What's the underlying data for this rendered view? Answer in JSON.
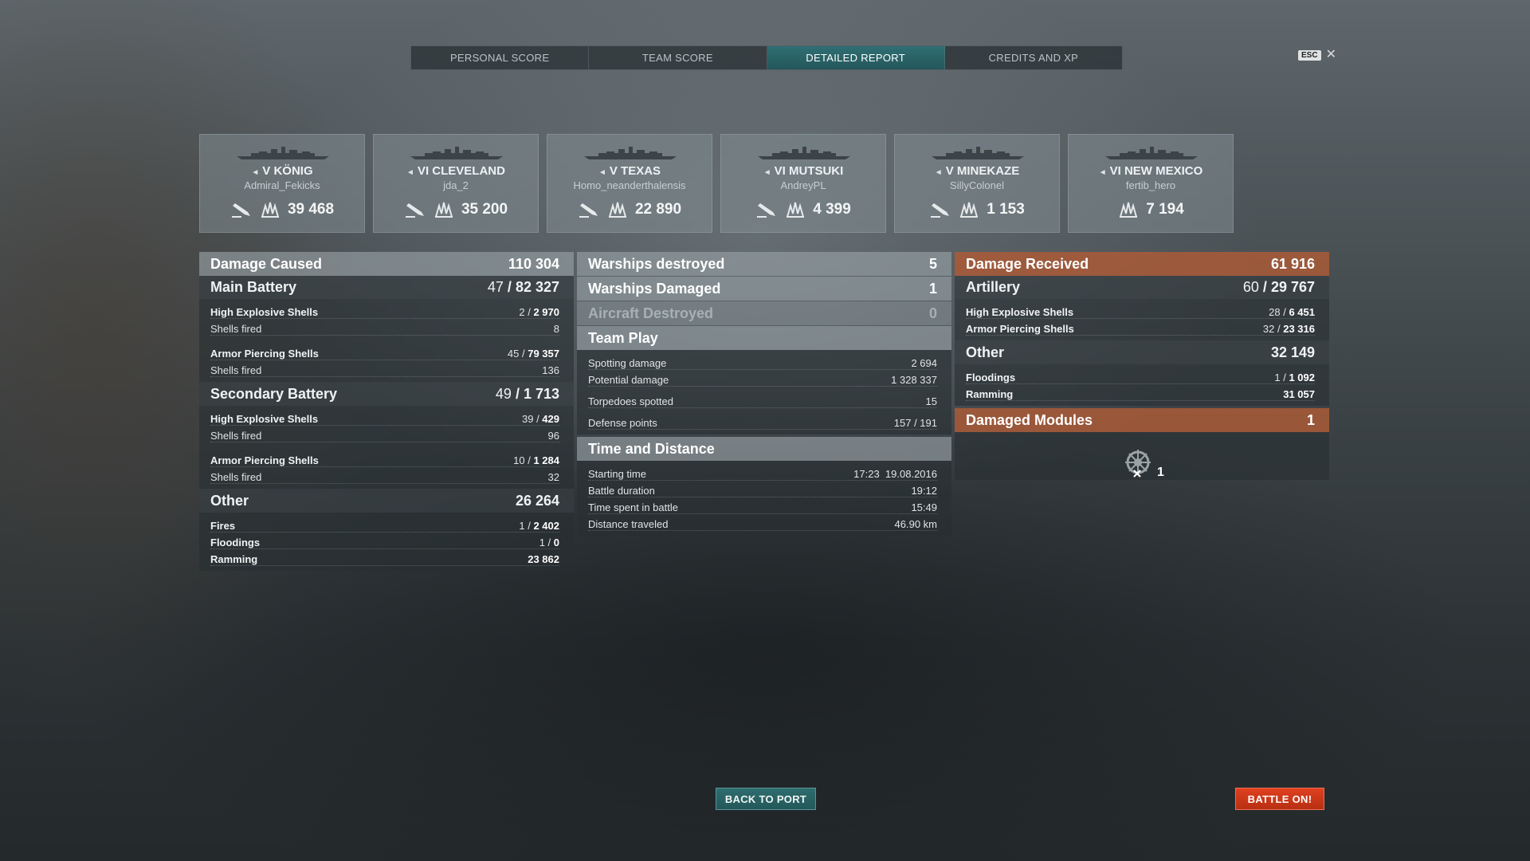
{
  "tabs": [
    "PERSONAL SCORE",
    "TEAM SCORE",
    "DETAILED REPORT",
    "CREDITS AND XP"
  ],
  "active_tab": "DETAILED REPORT",
  "esc": {
    "key": "ESC",
    "close": "✕"
  },
  "cards": [
    {
      "tier": "V",
      "ship": "KÖNIG",
      "player": "Admiral_Fekicks",
      "damage": "39 468",
      "has_torp": true
    },
    {
      "tier": "VI",
      "ship": "CLEVELAND",
      "player": "jda_2",
      "damage": "35 200",
      "has_torp": true
    },
    {
      "tier": "V",
      "ship": "TEXAS",
      "player": "Homo_neanderthalensis",
      "damage": "22 890",
      "has_torp": true
    },
    {
      "tier": "VI",
      "ship": "MUTSUKI",
      "player": "AndreyPL",
      "damage": "4 399",
      "has_torp": true
    },
    {
      "tier": "V",
      "ship": "MINEKAZE",
      "player": "SillyColonel",
      "damage": "1 153",
      "has_torp": true
    },
    {
      "tier": "VI",
      "ship": "NEW MEXICO",
      "player": "fertib_hero",
      "damage": "7 194",
      "has_torp": false
    }
  ],
  "left": {
    "damage_caused": {
      "label": "Damage Caused",
      "value": "110 304"
    },
    "main_battery": {
      "label": "Main Battery",
      "a": "47",
      "b": "82 327"
    },
    "mb_he": {
      "label": "High Explosive Shells",
      "a": "2",
      "b": "2 970"
    },
    "mb_he_fired": {
      "label": "Shells fired",
      "value": "8"
    },
    "mb_ap": {
      "label": "Armor Piercing Shells",
      "a": "45",
      "b": "79 357"
    },
    "mb_ap_fired": {
      "label": "Shells fired",
      "value": "136"
    },
    "secondary": {
      "label": "Secondary Battery",
      "a": "49",
      "b": "1 713"
    },
    "sb_he": {
      "label": "High Explosive Shells",
      "a": "39",
      "b": "429"
    },
    "sb_he_fired": {
      "label": "Shells fired",
      "value": "96"
    },
    "sb_ap": {
      "label": "Armor Piercing Shells",
      "a": "10",
      "b": "1 284"
    },
    "sb_ap_fired": {
      "label": "Shells fired",
      "value": "32"
    },
    "other": {
      "label": "Other",
      "value": "26 264"
    },
    "fires": {
      "label": "Fires",
      "a": "1",
      "b": "2 402"
    },
    "floodings": {
      "label": "Floodings",
      "a": "1",
      "b": "0"
    },
    "ramming": {
      "label": "Ramming",
      "value": "23 862"
    }
  },
  "middle": {
    "destroyed": {
      "label": "Warships destroyed",
      "value": "5"
    },
    "damaged": {
      "label": "Warships Damaged",
      "value": "1"
    },
    "aircraft": {
      "label": "Aircraft Destroyed",
      "value": "0"
    },
    "team_play": {
      "label": "Team Play"
    },
    "spotting": {
      "label": "Spotting damage",
      "value": "2 694"
    },
    "potential": {
      "label": "Potential damage",
      "value": "1 328 337"
    },
    "torpedoes": {
      "label": "Torpedoes spotted",
      "value": "15"
    },
    "defense": {
      "label": "Defense points",
      "value": "157 / 191"
    },
    "time_distance": {
      "label": "Time and Distance"
    },
    "start": {
      "label": "Starting time",
      "value": "17:23  19.08.2016"
    },
    "duration": {
      "label": "Battle duration",
      "value": "19:12"
    },
    "spent": {
      "label": "Time spent in battle",
      "value": "15:49"
    },
    "distance": {
      "label": "Distance traveled",
      "value": "46.90 km"
    }
  },
  "right": {
    "received": {
      "label": "Damage Received",
      "value": "61 916"
    },
    "artillery": {
      "label": "Artillery",
      "a": "60",
      "b": "29 767"
    },
    "he": {
      "label": "High Explosive Shells",
      "a": "28",
      "b": "6 451"
    },
    "ap": {
      "label": "Armor Piercing Shells",
      "a": "32",
      "b": "23 316"
    },
    "other": {
      "label": "Other",
      "value": "32 149"
    },
    "floodings": {
      "label": "Floodings",
      "a": "1",
      "b": "1 092"
    },
    "ramming": {
      "label": "Ramming",
      "value": "31 057"
    },
    "modules": {
      "label": "Damaged Modules",
      "value": "1"
    },
    "module_count": "1"
  },
  "buttons": {
    "back": "BACK TO PORT",
    "battle": "BATTLE ON!"
  },
  "colors": {
    "active_tab": "#2f6f74",
    "received_header": "#aa5a37",
    "battle_button": "#e0401f",
    "port_button": "#2f6d6e"
  }
}
